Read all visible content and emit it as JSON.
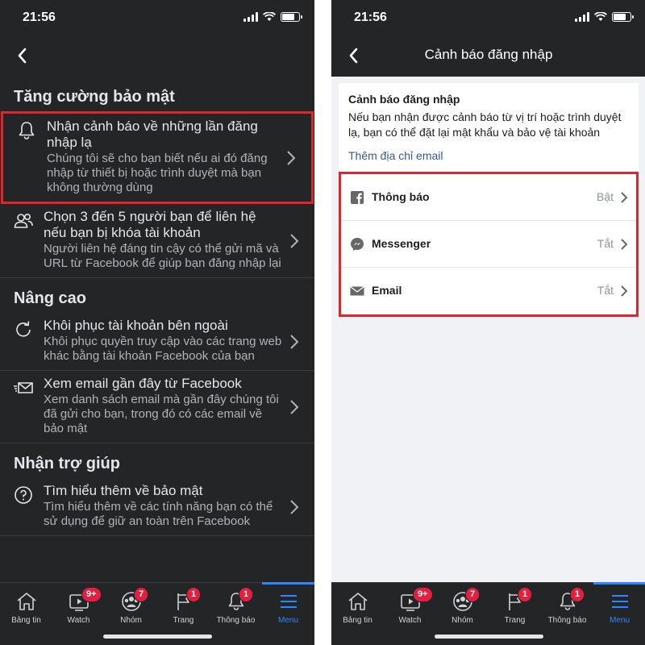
{
  "left": {
    "status_time": "21:56",
    "sections": [
      {
        "title": "Tăng cường bảo mật",
        "rows": [
          {
            "title": "Nhận cảnh báo về những lần đăng nhập lạ",
            "desc": "Chúng tôi sẽ cho bạn biết nếu ai đó đăng nhập từ thiết bị hoặc trình duyệt mà bạn không thường dùng",
            "icon": "bell-icon"
          },
          {
            "title": "Chọn 3 đến 5 người bạn để liên hệ nếu bạn bị khóa tài khoản",
            "desc": "Người liên hệ đáng tin cậy có thể gửi mã và URL từ Facebook để giúp bạn đăng nhập lại",
            "icon": "friends-icon"
          }
        ]
      },
      {
        "title": "Nâng cao",
        "rows": [
          {
            "title": "Khôi phục tài khoản bên ngoài",
            "desc": "Khôi phục quyền truy cập vào các trang web khác bằng tài khoản Facebook của bạn",
            "icon": "refresh-icon"
          },
          {
            "title": "Xem email gần đây từ Facebook",
            "desc": "Xem danh sách email mà gần đây chúng tôi đã gửi cho bạn, trong đó có các email về bảo mật",
            "icon": "envelope-icon"
          }
        ]
      },
      {
        "title": "Nhận trợ giúp",
        "rows": [
          {
            "title": "Tìm hiểu thêm về bảo mật",
            "desc": "Tìm hiểu thêm về các tính năng bạn có thể sử dụng để giữ an toàn trên Facebook",
            "icon": "help-icon"
          }
        ]
      }
    ]
  },
  "right": {
    "status_time": "21:56",
    "nav_title": "Cảnh báo đăng nhập",
    "card": {
      "title": "Cảnh báo đăng nhập",
      "desc": "Nếu bạn nhận được cảnh báo từ vị trí hoặc trình duyệt lạ, bạn có thể đặt lại mật khẩu và bảo vệ tài khoản",
      "link": "Thêm địa chỉ email"
    },
    "options": [
      {
        "label": "Thông báo",
        "status": "Bật",
        "icon": "facebook-icon"
      },
      {
        "label": "Messenger",
        "status": "Tắt",
        "icon": "messenger-icon"
      },
      {
        "label": "Email",
        "status": "Tắt",
        "icon": "mail-icon"
      }
    ]
  },
  "tabs": [
    {
      "label": "Bảng tin",
      "icon": "home-icon",
      "badge": ""
    },
    {
      "label": "Watch",
      "icon": "watch-icon",
      "badge": "9+"
    },
    {
      "label": "Nhóm",
      "icon": "groups-icon",
      "badge": "7"
    },
    {
      "label": "Trang",
      "icon": "flag-icon",
      "badge": "1"
    },
    {
      "label": "Thông báo",
      "icon": "bell-icon",
      "badge": "1"
    },
    {
      "label": "Menu",
      "icon": "menu-icon",
      "badge": ""
    }
  ],
  "colors": {
    "highlight": "#e0262b",
    "accent": "#2d88ff",
    "badge": "#e41e3f",
    "dark_bg": "#242526"
  }
}
